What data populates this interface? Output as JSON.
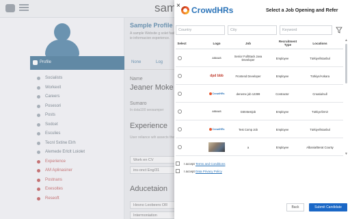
{
  "background": {
    "brand": "sam",
    "sidebar_active": "Profile",
    "sidebar_items": [
      {
        "label": "Socialists",
        "red": false
      },
      {
        "label": "Workexit",
        "red": false
      },
      {
        "label": "Careers",
        "red": false
      },
      {
        "label": "Posesori",
        "red": false
      },
      {
        "label": "Posts",
        "red": false
      },
      {
        "label": "Sodcet",
        "red": false
      },
      {
        "label": "Esculies",
        "red": false
      },
      {
        "label": "Tecnl Sxtine Elrh",
        "red": false
      },
      {
        "label": "Alemede Erlclt Loiolet",
        "red": false
      },
      {
        "label": "Experience",
        "red": true
      },
      {
        "label": "AM Aplinasiner",
        "red": true
      },
      {
        "label": "Postnans",
        "red": true
      },
      {
        "label": "Exesoites",
        "red": true
      },
      {
        "label": "Reseoft",
        "red": true
      }
    ],
    "main": {
      "title": "Sample Profile",
      "paragraph": "A sample Website g solet fasbo ie informacion experience.",
      "tabs": [
        "None",
        "Log"
      ],
      "name_label": "Name",
      "name_value": "Jeaner Moke",
      "summary_label": "Sumaro",
      "summary_text": "In dsta100 seosamper",
      "experience_heading": "Experience",
      "experience_text": "User reliance wih assects the vents at",
      "work_box_1": "Work en CV",
      "work_box_2": "ins-onct Eng/31",
      "education_heading": "Aducetaion",
      "edu_box_1": "Hesno Leobeers OR",
      "edu_box_2": "Intermoniation"
    }
  },
  "panel": {
    "close_label": "×",
    "logo_text": "CrowdHRs",
    "title": "Select a Job Opening and Refer",
    "filters": {
      "country_placeholder": "Country",
      "city_placeholder": "City",
      "keyword_placeholder": "Keyword"
    },
    "columns": {
      "select": "Select",
      "logo": "Logo",
      "job": "Job",
      "type": "Recruitment Type",
      "location": "Locations"
    },
    "rows": [
      {
        "logo": "AIDAAS",
        "logo_style": "plain",
        "job": "Senior FullStack Java Developer",
        "type": "Employee",
        "location": "Türkiye/İstanbul"
      },
      {
        "logo": "dpd bbb",
        "logo_style": "red",
        "job": "Frontend Developer",
        "type": "Employee",
        "location": "Türkiye/Ankara"
      },
      {
        "logo": "CrowdHRs",
        "logo_style": "crowd",
        "job": "deneme job 12399",
        "type": "Contractor",
        "location": "Croatia/null"
      },
      {
        "logo": "AIDAAS",
        "logo_style": "plain",
        "job": "D304testjob",
        "type": "Employee",
        "location": "Türkiye/İzmir"
      },
      {
        "logo": "CrowdHRs",
        "logo_style": "crowd",
        "job": "Test Comp Job",
        "job_full": "Test Comp Job",
        "type": "Employee",
        "location": "Türkiye/İstanbul"
      },
      {
        "logo": "",
        "logo_style": "photo",
        "job": "a",
        "type": "Employee",
        "location": "Albania/Berat County"
      }
    ],
    "agree_terms_prefix": "I accept",
    "agree_terms_link": "Terms and Conditions",
    "agree_privacy_prefix": "I accept",
    "agree_privacy_link": "Data Privacy Policy",
    "back_label": "Back",
    "submit_label": "Submit Candidate",
    "accent_color": "#1a67c6"
  }
}
